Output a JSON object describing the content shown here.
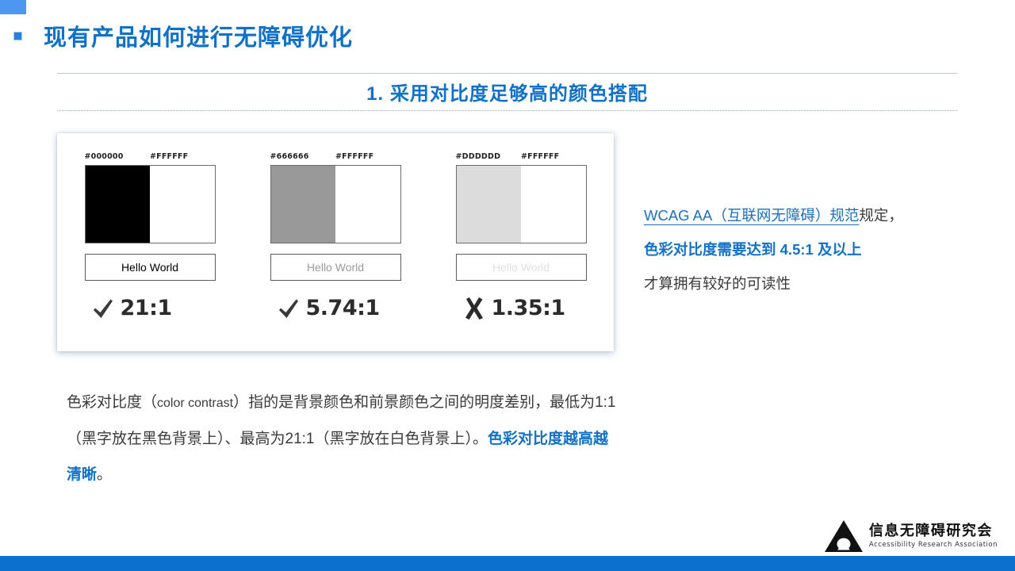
{
  "slide": {
    "title": "现有产品如何进行无障碍优化",
    "subtitle": "1.  采用对比度足够高的颜色搭配",
    "accent_color": "#1171c9",
    "bottom_bar_color": "#0a72ce",
    "corner_square_color": "#4e97f0"
  },
  "demo_card": {
    "groups": [
      {
        "fg_hex": "#000000",
        "bg_hex": "#FFFFFF",
        "fg_color": "#000000",
        "bg_color": "#FFFFFF",
        "sample_text": "Hello World",
        "sample_text_color": "#000000",
        "mark": "check-icon",
        "ratio": "21:1"
      },
      {
        "fg_hex": "#666666",
        "bg_hex": "#FFFFFF",
        "fg_color": "#999999",
        "bg_color": "#FFFFFF",
        "sample_text": "Hello World",
        "sample_text_color": "#9a9a9a",
        "mark": "check-icon",
        "ratio": "5.74:1"
      },
      {
        "fg_hex": "#DDDDDD",
        "bg_hex": "#FFFFFF",
        "fg_color": "#dcdcdc",
        "bg_color": "#FFFFFF",
        "sample_text": "Hello World",
        "sample_text_color": "#e0e0e0",
        "mark": "cross-icon",
        "ratio": "1.35:1"
      }
    ]
  },
  "side_note": {
    "line1_blue": "WCAG AA（互联网无障碍）规范",
    "line1_rest": "规定，",
    "line2": "色彩对比度需要达到 4.5:1 及以上",
    "line3": "才算拥有较好的可读性"
  },
  "body_paragraph": {
    "part1": "色彩对比度（",
    "part2_mono": "color contrast",
    "part3": "）指的是背景颜色和前景颜色之间的明度差别，最低为1:1（黑字放在黑色背景上）、最高为21:1（黑字放在白色背景上）。",
    "highlight": "色彩对比度越高越清晰",
    "part4": "。"
  },
  "logo": {
    "cn": "信息无障碍研究会",
    "en": "Accessibility Research Association"
  }
}
